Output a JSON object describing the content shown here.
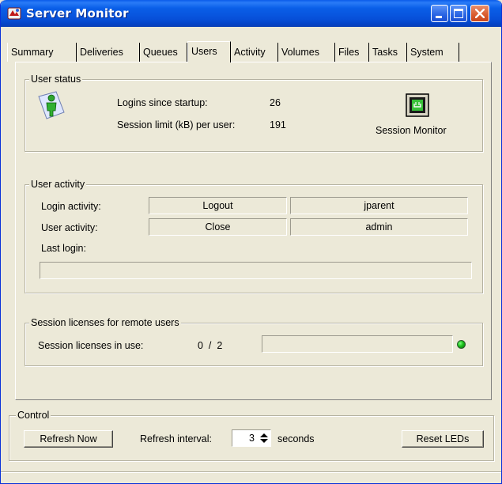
{
  "window": {
    "title": "Server Monitor"
  },
  "tabs": [
    {
      "label": "Summary"
    },
    {
      "label": "Deliveries"
    },
    {
      "label": "Queues"
    },
    {
      "label": "Users"
    },
    {
      "label": "Activity"
    },
    {
      "label": "Volumes"
    },
    {
      "label": "Files"
    },
    {
      "label": "Tasks"
    },
    {
      "label": "System"
    }
  ],
  "active_tab": "Users",
  "user_status": {
    "legend": "User status",
    "logins_label": "Logins since startup:",
    "logins_value": "26",
    "session_limit_label": "Session limit (kB) per user:",
    "session_limit_value": "191",
    "session_monitor_label": "Session Monitor"
  },
  "user_activity": {
    "legend": "User activity",
    "login_activity_label": "Login activity:",
    "login_activity_action": "Logout",
    "login_activity_user": "jparent",
    "user_activity_label": "User activity:",
    "user_activity_action": "Close",
    "user_activity_user": "admin",
    "last_login_label": "Last login:",
    "last_login_value": ""
  },
  "licenses": {
    "legend": "Session licenses for remote users",
    "in_use_label": "Session licenses in use:",
    "in_use_value": "0  /  2",
    "led_color": "#1bbf1b"
  },
  "control": {
    "legend": "Control",
    "refresh_button": "Refresh Now",
    "interval_label": "Refresh interval:",
    "interval_value": "3",
    "interval_unit": "seconds",
    "reset_button": "Reset LEDs"
  }
}
